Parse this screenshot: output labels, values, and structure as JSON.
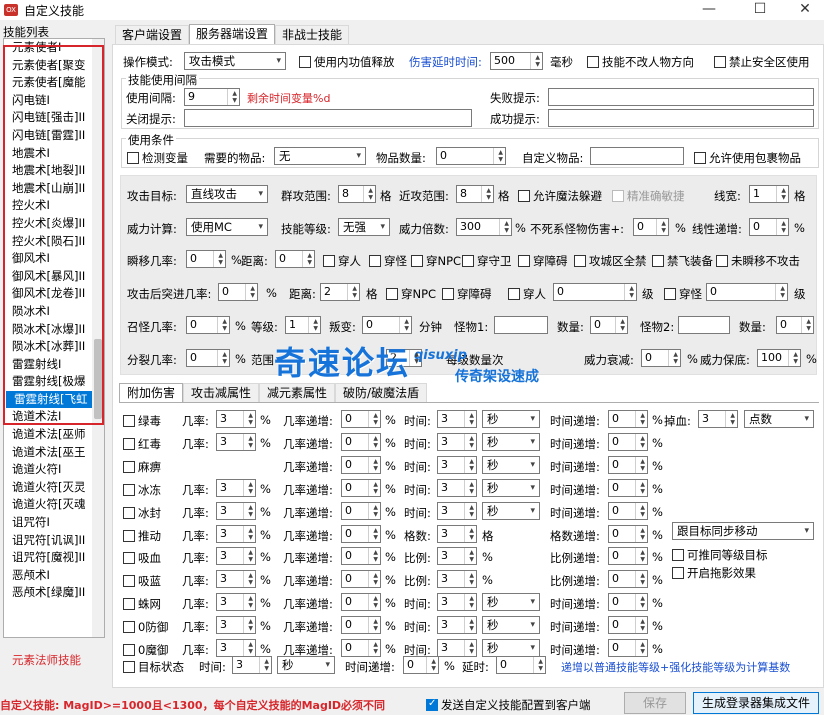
{
  "window": {
    "title": "自定义技能",
    "icon_text": "OX"
  },
  "left": {
    "header": "技能列表",
    "footer": "元素法师技能",
    "items": [
      "元素使者I",
      "元素使者[聚变",
      "元素使者[魔能",
      "闪电链I",
      "闪电链[强击]II",
      "闪电链[雷霆]II",
      "地震术I",
      "地震术[地裂]II",
      "地震术[山崩]II",
      "控火术I",
      "控火术[炎爆]II",
      "控火术[陨石]II",
      "御风术I",
      "御风术[暴风]II",
      "御风术[龙卷]II",
      "陨冰术I",
      "陨冰术[冰爆]II",
      "陨冰术[冰葬]II",
      "雷霆射线I",
      "雷霆射线[极爆",
      "雷霆射线[飞虹",
      "诡道术法I",
      "诡道术法[巫师",
      "诡道术法[巫王",
      "诡道火符I",
      "诡道火符[灭灵",
      "诡道火符[灭魂",
      "诅咒符I",
      "诅咒符[讥讽]II",
      "诅咒符[魔视]II",
      "恶颅术I",
      "恶颅术[绿魔]II"
    ],
    "selected_index": 20
  },
  "tabs": [
    "客户端设置",
    "服务器端设置",
    "非战士技能"
  ],
  "top": {
    "mode_label": "操作模式:",
    "mode_value": "攻击模式",
    "inner_cd_label": "使用内功值释放",
    "delay_label": "伤害延时时间:",
    "delay_value": "500",
    "ms": "毫秒",
    "no_dir_label": "技能不改人物方向",
    "no_safe_label": "禁止安全区使用",
    "interval_group": "技能使用间隔",
    "interval_label": "使用间隔:",
    "interval_value": "9",
    "remaining_var": "剩余时间变量%d",
    "fail_label": "失败提示:",
    "close_label": "关闭提示:",
    "success_label": "成功提示:",
    "cond_group": "使用条件",
    "detect_var": "检测变量",
    "need_item_label": "需要的物品:",
    "need_item_value": "无",
    "item_qty_label": "物品数量:",
    "item_qty_value": "0",
    "custom_item_label": "自定义物品:",
    "allow_bag": "允许使用包裹物品"
  },
  "gray": {
    "target_label": "攻击目标:",
    "target_value": "直线攻击",
    "group_label": "群攻范围:",
    "group_value": "8",
    "ge": "格",
    "near_label": "近攻范围:",
    "near_value": "8",
    "allow_dodge": "允许魔法躲避",
    "precise": "精准确敏捷",
    "line_label": "线宽:",
    "line_value": "1",
    "power_label": "威力计算:",
    "power_value": "使用MC",
    "level_label": "技能等级:",
    "level_value": "无强",
    "mult_label": "威力倍数:",
    "mult_value": "300",
    "pct": "%",
    "nonmon_label": "不死系怪物伤害+:",
    "nonmon_value": "0",
    "linear_label": "线性递增:",
    "linear_value": "0",
    "blink_label": "瞬移几率:",
    "blink_value": "0",
    "dist_label": "距离:",
    "dist_value": "0",
    "c_people": "穿人",
    "c_monster": "穿怪",
    "c_npc": "穿NPC",
    "c_guard": "穿守卫",
    "c_obst": "穿障碍",
    "c_siege": "攻城区全禁",
    "c_fly": "禁飞装备",
    "c_noblink": "未瞬移不攻击",
    "rush_label": "攻击后突进几率:",
    "rush_value": "0",
    "rdist_label": "距离:",
    "rdist_value": "2",
    "r_npc": "穿NPC",
    "r_obst": "穿障碍",
    "r_people": "穿人",
    "r_people_val": "0",
    "ji": "级",
    "r_monster": "穿怪",
    "r_monster_val": "0",
    "summon_label": "召怪几率:",
    "summon_value": "0",
    "lv_label": "等级:",
    "lv_value": "1",
    "mutate_label": "叛变:",
    "mutate_value": "0",
    "minutes": "分钟",
    "mon1_label": "怪物1:",
    "qty1_label": "数量:",
    "qty1_value": "0",
    "mon2_label": "怪物2:",
    "qty2_label": "数量:",
    "qty2_value": "0",
    "split_label": "分裂几率:",
    "split_value": "0",
    "range_label": "范围",
    "range_value": "2",
    "each_label": "每级数量次",
    "decay_label": "威力衰减:",
    "decay_value": "0",
    "min_label": "威力保底:",
    "min_value": "100"
  },
  "watermark": {
    "cn": "奇速论坛",
    "en": "qisuxip",
    "sub": "传奇架设速成"
  },
  "inner_tabs": [
    "附加伤害",
    "攻击减属性",
    "减元素属性",
    "破防/破魔法盾"
  ],
  "effects": [
    {
      "name": "绿毒",
      "a": "几率:",
      "av": "3",
      "b": "几率递增:",
      "bv": "0",
      "c": "时间:",
      "cv": "3",
      "d": "秒",
      "e": "时间递增:",
      "ev": "0"
    },
    {
      "name": "红毒",
      "a": "几率:",
      "av": "3",
      "b": "几率递增:",
      "bv": "0",
      "c": "时间:",
      "cv": "3",
      "d": "秒",
      "e": "时间递增:",
      "ev": "0"
    },
    {
      "name": "麻痹",
      "a": "",
      "av": "",
      "b": "几率递增:",
      "bv": "0",
      "c": "时间:",
      "cv": "3",
      "d": "秒",
      "e": "时间递增:",
      "ev": "0"
    },
    {
      "name": "冰冻",
      "a": "几率:",
      "av": "3",
      "b": "几率递增:",
      "bv": "0",
      "c": "时间:",
      "cv": "3",
      "d": "秒",
      "e": "时间递增:",
      "ev": "0"
    },
    {
      "name": "冰封",
      "a": "几率:",
      "av": "3",
      "b": "几率递增:",
      "bv": "0",
      "c": "时间:",
      "cv": "3",
      "d": "秒",
      "e": "时间递增:",
      "ev": "0"
    },
    {
      "name": "推动",
      "a": "几率:",
      "av": "3",
      "b": "几率递增:",
      "bv": "0",
      "c": "格数:",
      "cv": "3",
      "d": "格",
      "e": "格数递增:",
      "ev": "0"
    },
    {
      "name": "吸血",
      "a": "几率:",
      "av": "3",
      "b": "几率递增:",
      "bv": "0",
      "c": "比例:",
      "cv": "3",
      "d": "%",
      "e": "比例递增:",
      "ev": "0"
    },
    {
      "name": "吸蓝",
      "a": "几率:",
      "av": "3",
      "b": "几率递增:",
      "bv": "0",
      "c": "比例:",
      "cv": "3",
      "d": "%",
      "e": "比例递增:",
      "ev": "0"
    },
    {
      "name": "蛛网",
      "a": "几率:",
      "av": "3",
      "b": "几率递增:",
      "bv": "0",
      "c": "时间:",
      "cv": "3",
      "d": "秒",
      "e": "时间递增:",
      "ev": "0"
    },
    {
      "name": "0防御",
      "a": "几率:",
      "av": "3",
      "b": "几率递增:",
      "bv": "0",
      "c": "时间:",
      "cv": "3",
      "d": "秒",
      "e": "时间递增:",
      "ev": "0"
    },
    {
      "name": "0魔御",
      "a": "几率:",
      "av": "3",
      "b": "几率递增:",
      "bv": "0",
      "c": "时间:",
      "cv": "3",
      "d": "秒",
      "e": "时间递增:",
      "ev": "0"
    }
  ],
  "side": {
    "drop_label": "掉血:",
    "drop_value": "3",
    "drop_unit": "点数",
    "follow": "跟目标同步移动",
    "push_level": "可推同等级目标",
    "drag": "开启拖影效果"
  },
  "status_row": {
    "name": "目标状态",
    "time_label": "时间:",
    "time_value": "3",
    "unit": "秒",
    "inc_label": "时间递增:",
    "inc_value": "0",
    "delay_label": "延时:",
    "delay_value": "0",
    "note": "递增以普通技能等级+强化技能等级为计算基数"
  },
  "bottom": {
    "warning": "自定义技能: MagID>=1000且<1300，每个自定义技能的MagID必须不同",
    "send_label": "发送自定义技能配置到客户端",
    "save": "保存",
    "generate": "生成登录器集成文件"
  }
}
